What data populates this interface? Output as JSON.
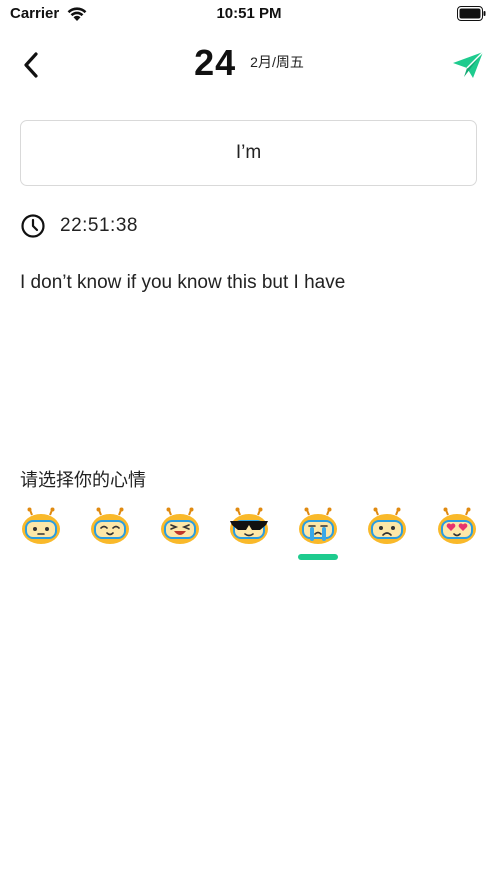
{
  "status_bar": {
    "carrier": "Carrier",
    "time": "10:51 PM"
  },
  "nav": {
    "day": "24",
    "date_sub": "2月/周五",
    "back_icon": "chevron-left-icon",
    "send_icon": "paper-plane-icon",
    "accent_color": "#1ecb8e"
  },
  "entry": {
    "title_value": "I’m",
    "time": "22:51:38",
    "body": "I don’t know if you know this but I have"
  },
  "mood": {
    "label": "请选择你的心情",
    "selected_index": 4,
    "items": [
      {
        "name": "neutral-face-icon"
      },
      {
        "name": "sleepy-face-icon"
      },
      {
        "name": "laughing-face-icon"
      },
      {
        "name": "cool-sunglasses-face-icon"
      },
      {
        "name": "crying-face-icon"
      },
      {
        "name": "sad-face-icon"
      },
      {
        "name": "heart-eyes-face-icon"
      }
    ]
  }
}
